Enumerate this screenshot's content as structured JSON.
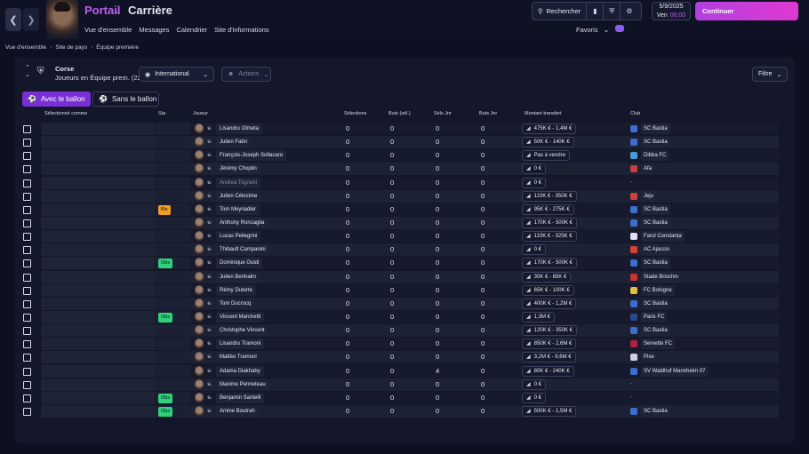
{
  "nav": {
    "back_icon": "chevron-left-icon",
    "forward_icon": "chevron-right-icon"
  },
  "header": {
    "portal": "Portail",
    "career": "Carrière",
    "links": [
      "Vue d'ensemble",
      "Messages",
      "Calendrier",
      "Site d'informations"
    ],
    "search_label": "Rechercher",
    "favorites_label": "Favoris",
    "date": "5/9/2025",
    "day": "Ven",
    "time": "00:00",
    "continue_label": "Continuer",
    "accent": "#c35cf2"
  },
  "breadcrumb": [
    "Vue d'ensemble",
    "Site de pays",
    "Équipe première"
  ],
  "team": {
    "name": "Corse",
    "subtitle": "Joueurs en Équipe prem. (22)",
    "scope_dropdown": "International",
    "actions_label": "Actions",
    "filter_label": "Filtre"
  },
  "tabs": {
    "with_ball": "Avec le ballon",
    "without_ball": "Sans le ballon"
  },
  "columns": {
    "selected_as": "Sélectionné comme",
    "status": "Sta",
    "player": "Joueur",
    "caps": "Sélections",
    "goals_sel": "Buts (sél.)",
    "youth_caps": "Séls Jnr",
    "youth_goals": "Buts Jnr",
    "transfer_value": "Montant transfert",
    "club": "Club"
  },
  "players": [
    {
      "name": "Lisandru Olmeta",
      "sta": "",
      "caps": "0",
      "goals": "0",
      "ycaps": "0",
      "ygoals": "0",
      "value": "475K € - 1,4M €",
      "club": "SC Bastia",
      "crest": "#3a6fd0"
    },
    {
      "name": "Julien Fabri",
      "sta": "",
      "caps": "0",
      "goals": "0",
      "ycaps": "0",
      "ygoals": "0",
      "value": "50K € - 140K €",
      "club": "SC Bastia",
      "crest": "#3a6fd0"
    },
    {
      "name": "François-Joseph Sollacaro",
      "sta": "",
      "caps": "0",
      "goals": "0",
      "ycaps": "0",
      "ygoals": "0",
      "value": "Pas à vendre",
      "club": "Dibba FC",
      "crest": "#4a9ad8"
    },
    {
      "name": "Jérémy Choplin",
      "sta": "",
      "caps": "0",
      "goals": "0",
      "ycaps": "0",
      "ygoals": "0",
      "value": "0 €",
      "club": "Afa",
      "crest": "#c84040"
    },
    {
      "name": "Andrea Tognoni",
      "sta": "",
      "caps": "0",
      "goals": "0",
      "ycaps": "0",
      "ygoals": "0",
      "value": "0 €",
      "club": "-",
      "crest": "",
      "dim": true
    },
    {
      "name": "Julien Célestine",
      "sta": "",
      "caps": "0",
      "goals": "0",
      "ycaps": "0",
      "ygoals": "0",
      "value": "110K € - 350K €",
      "club": "Jeju",
      "crest": "#d04040"
    },
    {
      "name": "Tom Meynadier",
      "sta": "Bls",
      "caps": "0",
      "goals": "0",
      "ycaps": "0",
      "ygoals": "0",
      "value": "95K € - 275K €",
      "club": "SC Bastia",
      "crest": "#3a6fd0"
    },
    {
      "name": "Anthony Roncaglia",
      "sta": "",
      "caps": "0",
      "goals": "0",
      "ycaps": "0",
      "ygoals": "0",
      "value": "170K € - 500K €",
      "club": "SC Bastia",
      "crest": "#3a6fd0"
    },
    {
      "name": "Lucas Pellegrini",
      "sta": "",
      "caps": "0",
      "goals": "0",
      "ycaps": "0",
      "ygoals": "0",
      "value": "110K € - 325K €",
      "club": "Farul Constanța",
      "crest": "#e0e0f0"
    },
    {
      "name": "Thibault Campanini",
      "sta": "",
      "caps": "0",
      "goals": "0",
      "ycaps": "0",
      "ygoals": "0",
      "value": "0 €",
      "club": "AC Ajaccio",
      "crest": "#d84030"
    },
    {
      "name": "Dominique Guidi",
      "sta": "Obs",
      "caps": "0",
      "goals": "0",
      "ycaps": "0",
      "ygoals": "0",
      "value": "170K € - 500K €",
      "club": "SC Bastia",
      "crest": "#3a6fd0"
    },
    {
      "name": "Julien Benhalm",
      "sta": "",
      "caps": "0",
      "goals": "0",
      "ycaps": "0",
      "ygoals": "0",
      "value": "30K € - 85K €",
      "club": "Stade Briochin",
      "crest": "#d03030"
    },
    {
      "name": "Rémy Duterte",
      "sta": "",
      "caps": "0",
      "goals": "0",
      "ycaps": "0",
      "ygoals": "0",
      "value": "65K € - 100K €",
      "club": "FC Bologne",
      "crest": "#e0c040"
    },
    {
      "name": "Tom Ducrocq",
      "sta": "",
      "caps": "0",
      "goals": "0",
      "ycaps": "0",
      "ygoals": "0",
      "value": "400K € - 1,2M €",
      "club": "SC Bastia",
      "crest": "#3a6fd0"
    },
    {
      "name": "Vincent Marchetti",
      "sta": "Obs",
      "caps": "0",
      "goals": "0",
      "ycaps": "0",
      "ygoals": "0",
      "value": "1,3M €",
      "club": "Paris FC",
      "crest": "#2a4a90"
    },
    {
      "name": "Christophe Vincent",
      "sta": "",
      "caps": "0",
      "goals": "0",
      "ycaps": "0",
      "ygoals": "0",
      "value": "120K € - 350K €",
      "club": "SC Bastia",
      "crest": "#3a6fd0"
    },
    {
      "name": "Lisandru Tramoni",
      "sta": "",
      "caps": "0",
      "goals": "0",
      "ycaps": "0",
      "ygoals": "0",
      "value": "850K € - 2,6M €",
      "club": "Servette FC",
      "crest": "#b02040"
    },
    {
      "name": "Mattéo Tramoni",
      "sta": "",
      "caps": "0",
      "goals": "0",
      "ycaps": "0",
      "ygoals": "0",
      "value": "3,2M € - 9,6M €",
      "club": "Pise",
      "crest": "#d0d0e0"
    },
    {
      "name": "Adama Diakhaby",
      "sta": "",
      "caps": "0",
      "goals": "0",
      "ycaps": "4",
      "ygoals": "0",
      "value": "80K € - 240K €",
      "club": "SV Waldhof Mannheim 07",
      "crest": "#3a6fd0"
    },
    {
      "name": "Maxime Penneteau",
      "sta": "",
      "caps": "0",
      "goals": "0",
      "ycaps": "0",
      "ygoals": "0",
      "value": "0 €",
      "club": "-",
      "crest": ""
    },
    {
      "name": "Benjamin Santelli",
      "sta": "Obs",
      "caps": "0",
      "goals": "0",
      "ycaps": "0",
      "ygoals": "0",
      "value": "0 €",
      "club": "-",
      "crest": ""
    },
    {
      "name": "Amine Boutrah",
      "sta": "Obs",
      "caps": "0",
      "goals": "0",
      "ycaps": "0",
      "ygoals": "0",
      "value": "500K € - 1,5M €",
      "club": "SC Bastia",
      "crest": "#3a6fd0"
    }
  ]
}
